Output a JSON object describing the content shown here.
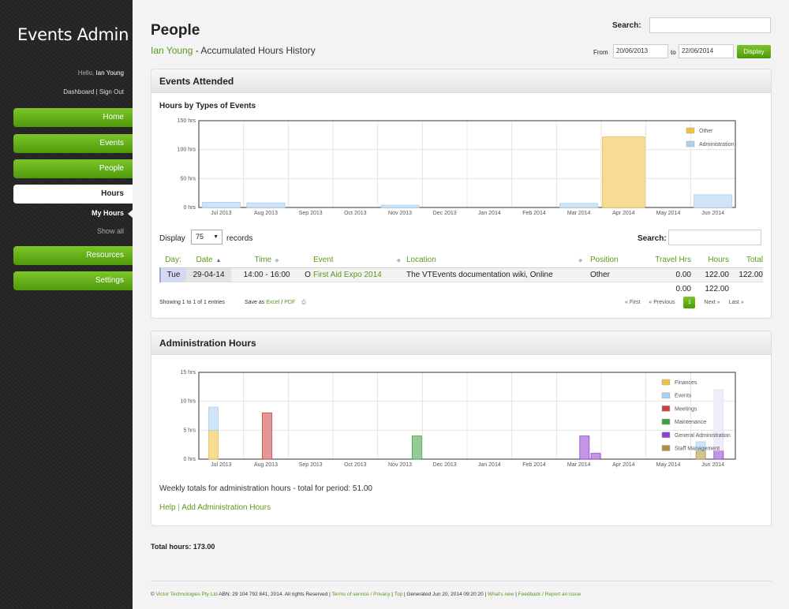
{
  "app": {
    "title": "Events Admin",
    "hello": "Hello,",
    "user": "Ian Young",
    "dashboard": "Dashboard",
    "sign_out": "Sign Out"
  },
  "nav": {
    "home": "Home",
    "events": "Events",
    "people": "People",
    "hours": "Hours",
    "my_hours": "My Hours",
    "show_all": "Show all",
    "resources": "Resources",
    "settings": "Settings"
  },
  "header": {
    "title": "People",
    "person": "Ian Young",
    "subtitle_rest": " - Accumulated Hours History",
    "search_label": "Search:",
    "from_label": "From",
    "from_value": "20/06/2013",
    "to_label": "to",
    "to_value": "22/06/2014",
    "display_button": "Display"
  },
  "events_panel": {
    "title": "Events Attended",
    "chart_title": "Hours by Types of Events",
    "display_label": "Display",
    "display_value": "75",
    "records_label": "records",
    "search_label": "Search:",
    "columns": [
      "Day",
      "Date",
      "Time",
      "",
      "Event",
      "Location",
      "Position",
      "Travel Hrs",
      "Hours",
      "Total"
    ],
    "row": {
      "day": "Tue",
      "date": "29-04-14",
      "time": "14:00 - 16:00",
      "flag": "O",
      "event": "First Aid Expo 2014",
      "location": "The VTEvents documentation wiki, Online",
      "position": "Other",
      "travel": "0.00",
      "hours": "122.00",
      "total": "122.00"
    },
    "totals": {
      "travel": "0.00",
      "hours": "122.00"
    },
    "info": "Showing 1 to 1 of 1 entries",
    "save_as": "Save as",
    "excel": "Excel",
    "pdf": "PDF",
    "pager": {
      "first": "« First",
      "previous": "« Previous",
      "page": "1",
      "next": "Next »",
      "last": "Last »"
    }
  },
  "admin_panel": {
    "title": "Administration Hours",
    "weekly_total": "Weekly totals for administration hours - total for period: 51.00",
    "help": "Help",
    "add": "Add Administration Hours"
  },
  "total_hours": "Total hours: 173.00",
  "footer": {
    "company": "Victor Technologies Pty Ltd",
    "abn": " ABN: 29 104 792 841, 2014. All rights Reserved | ",
    "terms": "Terms of service / Privacy",
    "sep1": " | ",
    "top": "Top",
    "generated": " | Generated Jun 20, 2014 09:20:20 | ",
    "whats_new": "What's new",
    "sep2": " | ",
    "feedback": "Feedback / Report an issue"
  },
  "chart_data": [
    {
      "type": "bar",
      "title": "Hours by Types of Events",
      "categories": [
        "Jul 2013",
        "Aug 2013",
        "Sep 2013",
        "Oct 2013",
        "Nov 2013",
        "Dec 2013",
        "Jan 2014",
        "Feb 2014",
        "Mar 2014",
        "Apr 2014",
        "May 2014",
        "Jun 2014"
      ],
      "yticks": [
        "0 hrs",
        "50 hrs",
        "100 hrs",
        "150 hrs"
      ],
      "ylim": [
        0,
        150
      ],
      "legend_position": "top-right",
      "series": [
        {
          "name": "Other",
          "color": "#f0c040",
          "values": [
            0,
            0,
            0,
            0,
            0,
            0,
            0,
            0,
            0,
            122,
            0,
            0
          ]
        },
        {
          "name": "Administration",
          "color": "#a8d0f0",
          "values": [
            9,
            8,
            0,
            0,
            4,
            0,
            0,
            0,
            7,
            0,
            0,
            22
          ]
        }
      ]
    },
    {
      "type": "bar",
      "stacked": true,
      "title": "",
      "categories": [
        "Jul 2013",
        "Aug 2013",
        "Sep 2013",
        "Oct 2013",
        "Nov 2013",
        "Dec 2013",
        "Jan 2014",
        "Feb 2014",
        "Mar 2014",
        "Apr 2014",
        "May 2014",
        "Jun 2014"
      ],
      "yticks": [
        "0 hrs",
        "5 hrs",
        "10 hrs",
        "15 hrs"
      ],
      "ylim": [
        0,
        15
      ],
      "legend_position": "top-right",
      "legend": [
        {
          "name": "Finances",
          "color": "#f0c040"
        },
        {
          "name": "Events",
          "color": "#a8d0f0"
        },
        {
          "name": "Meetings",
          "color": "#d04040"
        },
        {
          "name": "Maintenance",
          "color": "#40a040"
        },
        {
          "name": "General Administration",
          "color": "#9040d0"
        },
        {
          "name": "Staff Management",
          "color": "#b09040"
        }
      ],
      "bars": [
        {
          "x": 0.15,
          "segments": [
            {
              "color": "#f0c040",
              "value": 5
            },
            {
              "color": "#a8d0f0",
              "value": 4
            }
          ]
        },
        {
          "x": 1.35,
          "segments": [
            {
              "color": "#d04040",
              "value": 8
            }
          ]
        },
        {
          "x": 4.7,
          "segments": [
            {
              "color": "#40a040",
              "value": 4
            }
          ]
        },
        {
          "x": 8.45,
          "segments": [
            {
              "color": "#9040d0",
              "value": 4
            }
          ]
        },
        {
          "x": 8.7,
          "segments": [
            {
              "color": "#9040d0",
              "value": 1
            }
          ]
        },
        {
          "x": 11.05,
          "segments": [
            {
              "color": "#b09040",
              "value": 1.5
            },
            {
              "color": "#a8d0f0",
              "value": 1.5
            }
          ]
        },
        {
          "x": 11.45,
          "segments": [
            {
              "color": "#9040d0",
              "value": 1.5
            },
            {
              "color": "#e0e0f8",
              "value": 10.5
            }
          ]
        }
      ]
    }
  ]
}
